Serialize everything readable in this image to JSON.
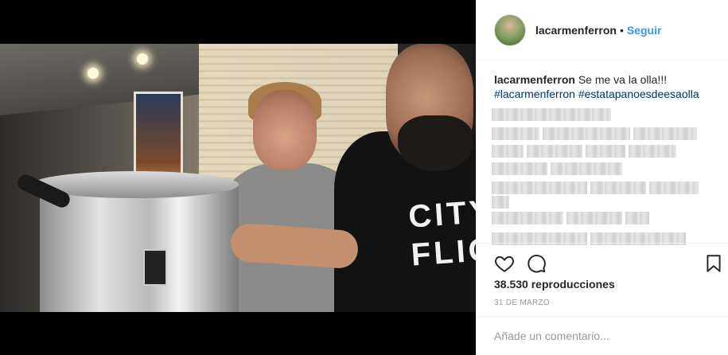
{
  "post": {
    "username": "lacarmenferron",
    "dot": "•",
    "follow_label": "Seguir",
    "caption_username": "lacarmenferron",
    "caption_text": "Se me va la olla!!!",
    "hashtags": [
      "#lacarmenferron",
      "#estatapanoesdeesaolla"
    ],
    "views": "38.530 reproducciones",
    "date": "31 DE MARZO",
    "comment_placeholder": "Añade un comentario..."
  },
  "video": {
    "shirt_text_line1": "CITY",
    "shirt_text_line2": "FLIG"
  },
  "icons": {
    "like": "heart-icon",
    "comment": "speech-bubble-icon",
    "save": "bookmark-icon"
  },
  "colors": {
    "follow": "#3897f0",
    "hashtag": "#003569",
    "muted": "#999999",
    "border": "#efefef"
  }
}
